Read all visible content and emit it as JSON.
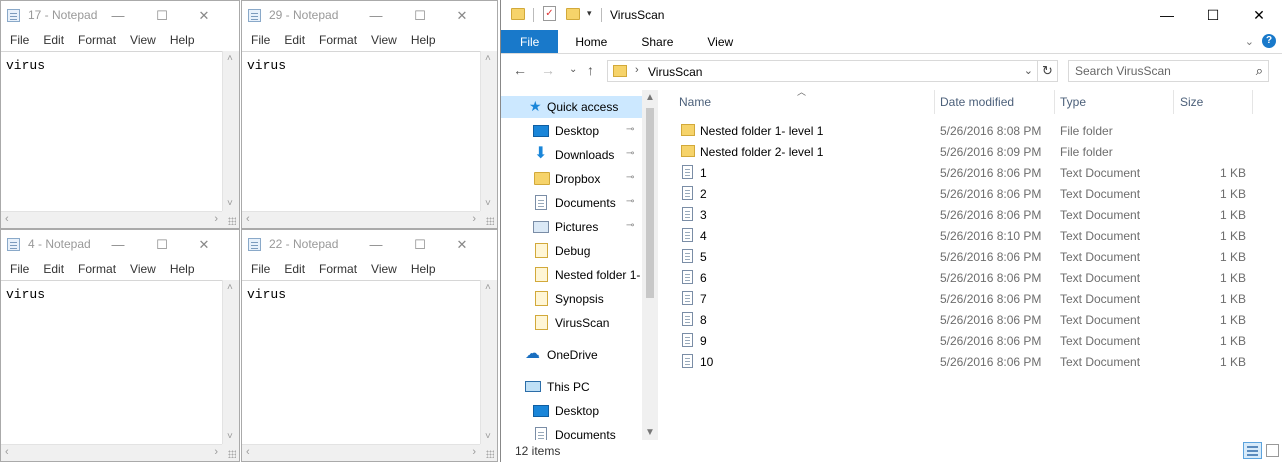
{
  "notepads": [
    {
      "title": "17 - Notepad",
      "menu": [
        "File",
        "Edit",
        "Format",
        "View",
        "Help"
      ],
      "content": "virus"
    },
    {
      "title": "29 - Notepad",
      "menu": [
        "File",
        "Edit",
        "Format",
        "View",
        "Help"
      ],
      "content": "virus"
    },
    {
      "title": "4 - Notepad",
      "menu": [
        "File",
        "Edit",
        "Format",
        "View",
        "Help"
      ],
      "content": "virus"
    },
    {
      "title": "22 - Notepad",
      "menu": [
        "File",
        "Edit",
        "Format",
        "View",
        "Help"
      ],
      "content": "virus"
    }
  ],
  "explorer": {
    "title": "VirusScan",
    "ribbon_tabs": [
      "File",
      "Home",
      "Share",
      "View"
    ],
    "address": {
      "crumb": "VirusScan"
    },
    "search": {
      "placeholder": "Search VirusScan"
    },
    "nav": {
      "quick_access": "Quick access",
      "items": [
        {
          "label": "Desktop",
          "icon": "desktop-icon",
          "pinned": true
        },
        {
          "label": "Downloads",
          "icon": "downloads-icon",
          "pinned": true
        },
        {
          "label": "Dropbox",
          "icon": "folder-icon",
          "pinned": true
        },
        {
          "label": "Documents",
          "icon": "documents-icon",
          "pinned": true
        },
        {
          "label": "Pictures",
          "icon": "pictures-icon",
          "pinned": true
        },
        {
          "label": "Debug",
          "icon": "folder-icon",
          "pinned": false
        },
        {
          "label": "Nested folder 1-",
          "icon": "folder-icon",
          "pinned": false
        },
        {
          "label": "Synopsis",
          "icon": "folder-icon",
          "pinned": false
        },
        {
          "label": "VirusScan",
          "icon": "folder-icon",
          "pinned": false
        }
      ],
      "onedrive": "OneDrive",
      "this_pc": "This PC",
      "pc_items": [
        "Desktop",
        "Documents"
      ]
    },
    "columns": {
      "name": "Name",
      "date": "Date modified",
      "type": "Type",
      "size": "Size"
    },
    "files": [
      {
        "name": "Nested folder 1- level 1",
        "date": "5/26/2016 8:08 PM",
        "type": "File folder",
        "size": "",
        "kind": "folder"
      },
      {
        "name": "Nested folder 2- level 1",
        "date": "5/26/2016 8:09 PM",
        "type": "File folder",
        "size": "",
        "kind": "folder"
      },
      {
        "name": "1",
        "date": "5/26/2016 8:06 PM",
        "type": "Text Document",
        "size": "1 KB",
        "kind": "doc"
      },
      {
        "name": "2",
        "date": "5/26/2016 8:06 PM",
        "type": "Text Document",
        "size": "1 KB",
        "kind": "doc"
      },
      {
        "name": "3",
        "date": "5/26/2016 8:06 PM",
        "type": "Text Document",
        "size": "1 KB",
        "kind": "doc"
      },
      {
        "name": "4",
        "date": "5/26/2016 8:10 PM",
        "type": "Text Document",
        "size": "1 KB",
        "kind": "doc"
      },
      {
        "name": "5",
        "date": "5/26/2016 8:06 PM",
        "type": "Text Document",
        "size": "1 KB",
        "kind": "doc"
      },
      {
        "name": "6",
        "date": "5/26/2016 8:06 PM",
        "type": "Text Document",
        "size": "1 KB",
        "kind": "doc"
      },
      {
        "name": "7",
        "date": "5/26/2016 8:06 PM",
        "type": "Text Document",
        "size": "1 KB",
        "kind": "doc"
      },
      {
        "name": "8",
        "date": "5/26/2016 8:06 PM",
        "type": "Text Document",
        "size": "1 KB",
        "kind": "doc"
      },
      {
        "name": "9",
        "date": "5/26/2016 8:06 PM",
        "type": "Text Document",
        "size": "1 KB",
        "kind": "doc"
      },
      {
        "name": "10",
        "date": "5/26/2016 8:06 PM",
        "type": "Text Document",
        "size": "1 KB",
        "kind": "doc"
      }
    ],
    "status": {
      "count": "12 items"
    }
  },
  "colors": {
    "accent": "#1979ca",
    "selection": "#cce8ff",
    "header_text": "#4c607a"
  }
}
